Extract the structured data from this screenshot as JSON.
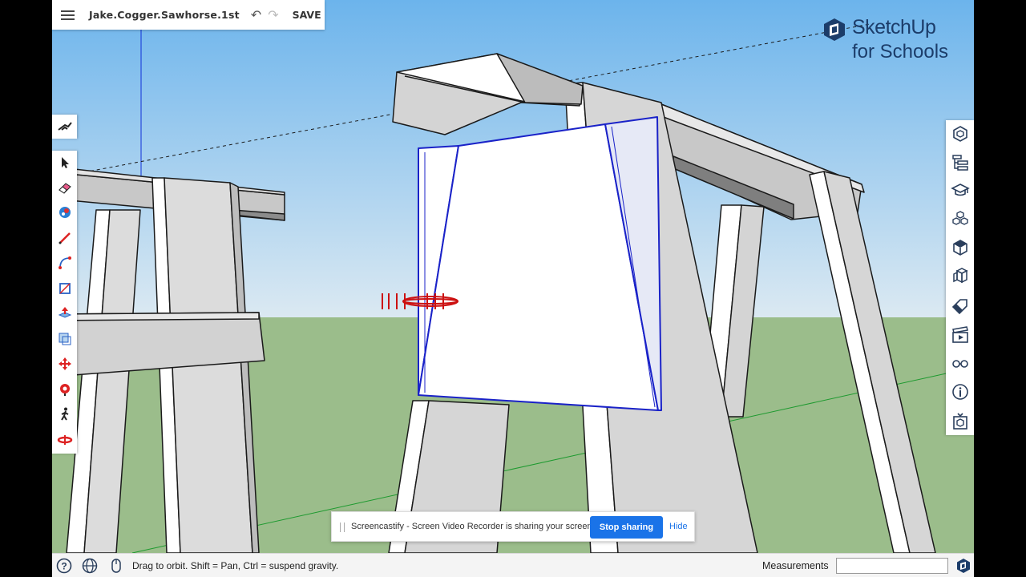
{
  "topbar": {
    "file_name": "Jake.Cogger.Sawhorse.1st",
    "save_label": "SAVE"
  },
  "logo": {
    "line1": "SketchUp",
    "line2": "for Schools",
    "color": "#1c3d6a"
  },
  "left_toolbar": {
    "top_tool": "orbit-walk-icon",
    "tools": [
      "select-arrow-icon",
      "eraser-icon",
      "paint-bucket-icon",
      "pencil-line-icon",
      "arc-icon",
      "rectangle-icon",
      "push-pull-icon",
      "offset-icon",
      "move-icon",
      "tape-measure-icon",
      "walk-icon",
      "orbit-icon"
    ]
  },
  "right_toolbar": {
    "tools": [
      "entity-info-icon",
      "outliner-icon",
      "instructor-icon",
      "components-icon",
      "materials-icon",
      "styles-icon",
      "tags-icon",
      "scenes-icon",
      "display-icon",
      "model-info-icon",
      "3d-warehouse-icon"
    ]
  },
  "status": {
    "hint": "Drag to orbit. Shift = Pan, Ctrl = suspend gravity.",
    "measurements_label": "Measurements",
    "measurements_value": ""
  },
  "share_bar": {
    "message": "Screencastify - Screen Video Recorder is sharing your screen.",
    "stop_label": "Stop sharing",
    "hide_label": "Hide",
    "accent": "#1a73e8"
  },
  "colors": {
    "sky_top": "#6cb4ec",
    "sky_bottom": "#dbe9f2",
    "ground": "#9bbd8b",
    "selection": "#1a22c8"
  }
}
